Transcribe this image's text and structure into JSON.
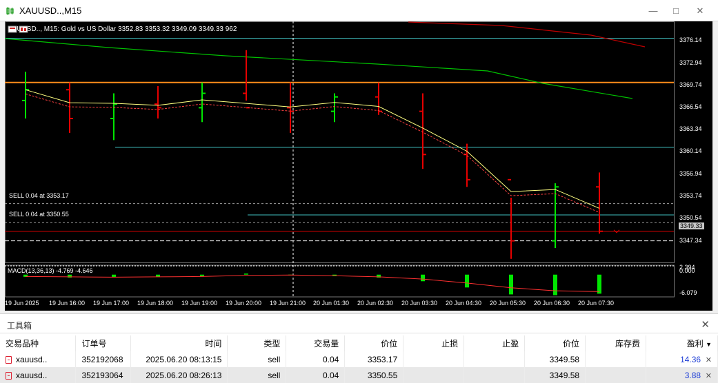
{
  "window": {
    "title": "XAUUSD..,M15"
  },
  "chart": {
    "header": "XAUUSD.., M15:  Gold vs US Dollar  3352.83 3353.32 3349.09 3349.33  962",
    "trade_labels": [
      "SELL 0.04 at 3353.17",
      "SELL 0.04 at 3350.55"
    ],
    "macd_label": "MACD(13,36,13) -4.769 -4.646",
    "price_ticks": [
      "3376.14",
      "3372.94",
      "3369.74",
      "3366.54",
      "3363.34",
      "3360.14",
      "3356.94",
      "3353.74",
      "3350.54",
      "3347.34"
    ],
    "current_price": "3349.33",
    "macd_ticks": [
      "2.394",
      "0.000",
      "-6.079"
    ],
    "time_ticks": [
      "19 Jun 2025",
      "19 Jun 16:00",
      "19 Jun 17:00",
      "19 Jun 18:00",
      "19 Jun 19:00",
      "19 Jun 20:00",
      "19 Jun 21:00",
      "20 Jun 01:30",
      "20 Jun 02:30",
      "20 Jun 03:30",
      "20 Jun 04:30",
      "20 Jun 05:30",
      "20 Jun 06:30",
      "20 Jun 07:30"
    ],
    "colors": {
      "bull": "#00e600",
      "bear": "#e60000",
      "fast_ma": "#ffff80",
      "slow_ma": "#00c000",
      "long_ma": "#c00000",
      "level": "#ff8c1a",
      "hline": "#40c0c0"
    }
  },
  "chart_data": {
    "type": "candlestick",
    "x": [
      "19 Jun 2025",
      "19 Jun 16:00",
      "19 Jun 17:00",
      "19 Jun 18:00",
      "19 Jun 19:00",
      "19 Jun 20:00",
      "19 Jun 21:00",
      "20 Jun 01:30",
      "20 Jun 02:30",
      "20 Jun 03:30",
      "20 Jun 04:30",
      "20 Jun 05:30",
      "20 Jun 06:30",
      "20 Jun 07:30"
    ],
    "ohlc": [
      [
        3367.5,
        3371.5,
        3365.0,
        3369.0
      ],
      [
        3369.0,
        3370.0,
        3363.0,
        3365.0
      ],
      [
        3365.0,
        3368.5,
        3362.0,
        3367.0
      ],
      [
        3367.0,
        3369.5,
        3365.0,
        3366.5
      ],
      [
        3366.5,
        3370.0,
        3364.5,
        3368.5
      ],
      [
        3368.5,
        3374.5,
        3367.5,
        3366.5
      ],
      [
        3366.5,
        3370.0,
        3363.0,
        3366.0
      ],
      [
        3366.0,
        3368.5,
        3364.5,
        3368.0
      ],
      [
        3368.0,
        3370.0,
        3365.5,
        3366.0
      ],
      [
        3366.0,
        3368.5,
        3358.0,
        3360.0
      ],
      [
        3360.0,
        3361.5,
        3355.5,
        3356.5
      ],
      [
        3356.5,
        3354.0,
        3345.5,
        3348.0
      ],
      [
        3348.0,
        3356.0,
        3347.0,
        3355.5
      ],
      [
        3355.5,
        3357.5,
        3349.0,
        3349.33
      ]
    ],
    "ylim": [
      3345.0,
      3378.5
    ],
    "levels": {
      "orange": 3370.0,
      "sell_1": 3353.17,
      "sell_2": 3350.55
    },
    "macd": {
      "ylim": [
        -6.079,
        2.394
      ],
      "histogram": [
        -0.6,
        -0.8,
        -0.7,
        -0.6,
        -0.4,
        0.3,
        -0.1,
        -0.4,
        -0.8,
        -1.8,
        -3.5,
        -5.4,
        -5.6,
        -5.2
      ],
      "signal": [
        -0.5,
        -0.6,
        -0.7,
        -0.6,
        -0.5,
        -0.2,
        -0.1,
        -0.3,
        -0.6,
        -1.2,
        -2.3,
        -3.6,
        -4.4,
        -4.65
      ]
    }
  },
  "toolbox": {
    "title": "工具箱",
    "columns": [
      "交易品种",
      "订单号",
      "时间",
      "类型",
      "交易量",
      "价位",
      "止损",
      "止盈",
      "价位",
      "库存费",
      "盈利"
    ],
    "rows": [
      {
        "symbol": "xauusd..",
        "order": "352192068",
        "time": "2025.06.20 08:13:15",
        "type": "sell",
        "volume": "0.04",
        "price": "3353.17",
        "sl": "",
        "tp": "",
        "cur_price": "3349.58",
        "swap": "",
        "profit": "14.36"
      },
      {
        "symbol": "xauusd..",
        "order": "352193064",
        "time": "2025.06.20 08:26:13",
        "type": "sell",
        "volume": "0.04",
        "price": "3350.55",
        "sl": "",
        "tp": "",
        "cur_price": "3349.58",
        "swap": "",
        "profit": "3.88"
      }
    ]
  }
}
